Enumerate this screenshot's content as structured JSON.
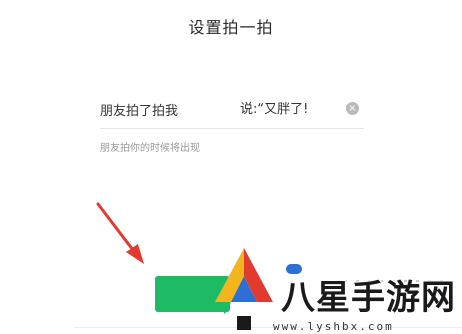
{
  "header": {
    "title": "设置拍一拍"
  },
  "pat": {
    "prefix": "朋友拍了拍我",
    "suffix_value": "说:“又胖了!",
    "clear_symbol": "×",
    "hint": "朋友拍你的时候将出现"
  },
  "watermark": {
    "name": "八星手游网",
    "url": "www.lyshbx.com"
  },
  "colors": {
    "accent_green": "#1dbb63",
    "arrow_red": "#e23a2f",
    "blue": "#2c6fd6"
  }
}
